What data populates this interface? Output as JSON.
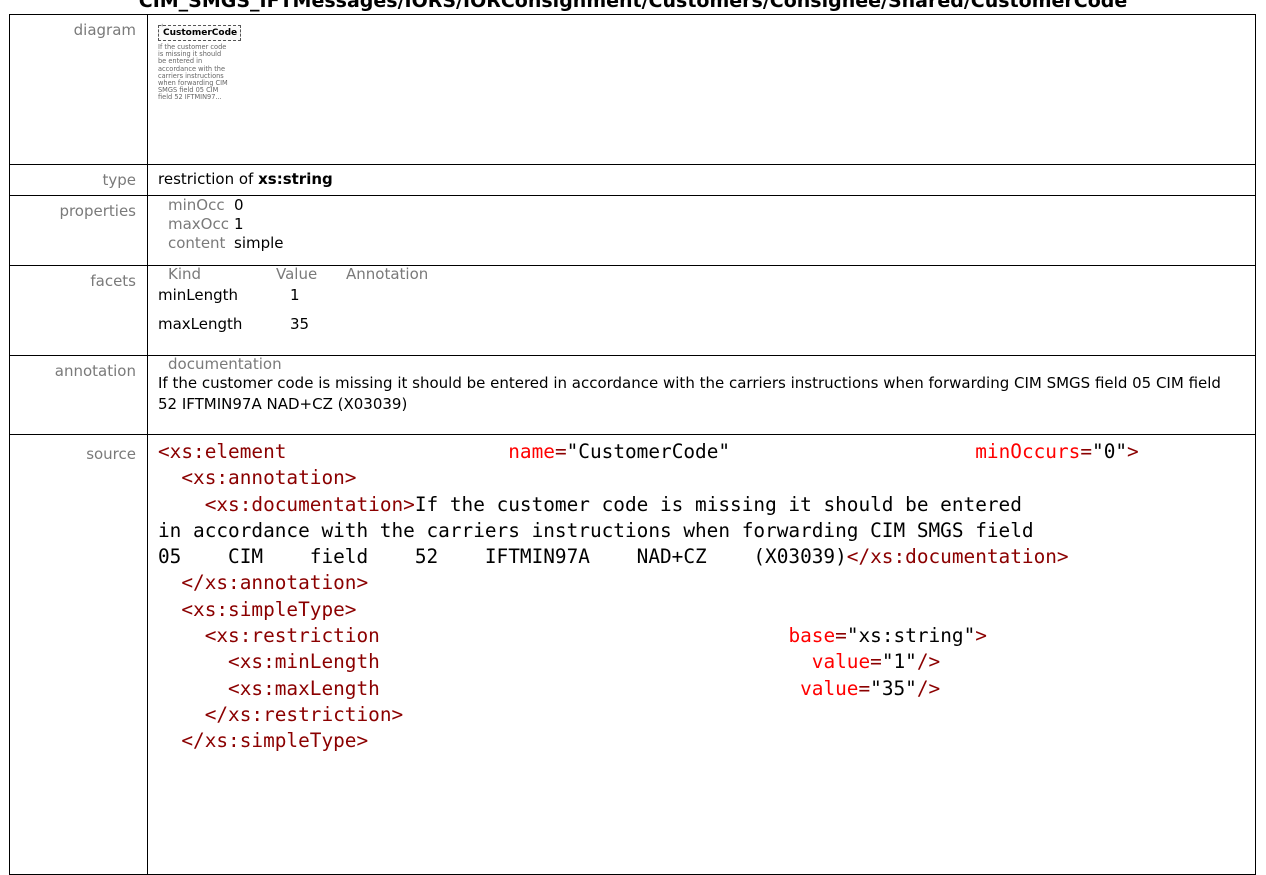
{
  "page": {
    "title": "CIM_SMGS_IFTMessages/IORS/IORConsignment/Customers/Consignee/Shared/CustomerCode"
  },
  "labels": {
    "diagram": "diagram",
    "type": "type",
    "properties": "properties",
    "facets": "facets",
    "annotation": "annotation",
    "source": "source"
  },
  "diagram": {
    "element_name": "CustomerCode",
    "doc_text": "If the customer code is missing it should be entered in accordance with the carriers instructions when forwarding CIM SMGS field 05 CIM field 52 IFTMIN97..."
  },
  "type": {
    "prefix": "restriction of",
    "base": "xs:string"
  },
  "properties": [
    {
      "key": "minOcc",
      "value": "0"
    },
    {
      "key": "maxOcc",
      "value": "1"
    },
    {
      "key": "content",
      "value": "simple"
    }
  ],
  "facets": {
    "headers": [
      "Kind",
      "Value",
      "Annotation"
    ],
    "rows": [
      {
        "kind": "minLength",
        "value": "1"
      },
      {
        "kind": "maxLength",
        "value": "35"
      }
    ]
  },
  "annotation": {
    "heading": "documentation",
    "text": "If the customer code is missing it should be entered in accordance with the carriers instructions when forwarding CIM SMGS field 05 CIM field 52 IFTMIN97A NAD+CZ (X03039)"
  },
  "source": {
    "l1_tag": "<xs:element",
    "l1_attr1": "name",
    "l1_val1": "\"CustomerCode\"",
    "l1_attr2": "minOccurs",
    "l1_val2": "\"0\"",
    "l1_end": ">",
    "l2": "<xs:annotation>",
    "l3_open": "<xs:documentation>",
    "l3_text": "If the customer code is missing it should be entered",
    "l4_text": "in accordance with the carriers instructions when forwarding CIM SMGS field",
    "l5_text": "05    CIM    field    52    IFTMIN97A    NAD+CZ    (X03039)",
    "l5_close": "</xs:documentation>",
    "l6": "</xs:annotation>",
    "l7": "<xs:simpleType>",
    "l8_tag": "<xs:restriction",
    "l8_attr": "base",
    "l8_val": "\"xs:string\"",
    "l8_end": ">",
    "l9_tag": "<xs:minLength",
    "l9_attr": "value",
    "l9_val": "\"1\"",
    "l9_end": "/>",
    "l10_tag": "<xs:maxLength",
    "l10_attr": "value",
    "l10_val": "\"35\"",
    "l10_end": "/>",
    "l11": "</xs:restriction>",
    "l12": "</xs:simpleType>",
    "eq": "="
  }
}
